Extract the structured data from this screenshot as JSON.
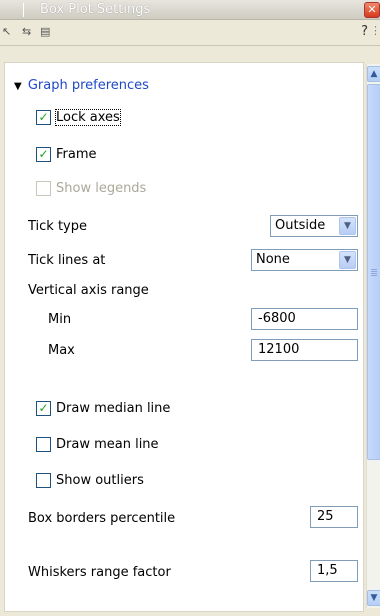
{
  "window": {
    "title": "Box Plot Settings",
    "close_glyph": "✕"
  },
  "toolbar": {
    "icons": [
      "cursor-arrow-icon",
      "cursor-arrows-icon",
      "layout-icon"
    ],
    "help": "?",
    "more": "⋮"
  },
  "section": {
    "title": "Graph preferences"
  },
  "options": {
    "lock_axes": {
      "label": "Lock axes",
      "checked": true
    },
    "frame": {
      "label": "Frame",
      "checked": true
    },
    "show_legends": {
      "label": "Show legends",
      "checked": false,
      "disabled": true
    }
  },
  "tick_type": {
    "label": "Tick type",
    "value": "Outside"
  },
  "tick_lines": {
    "label": "Tick lines at",
    "value": "None"
  },
  "vertical_axis": {
    "label": "Vertical axis range",
    "min_label": "Min",
    "min_value": "-6800",
    "max_label": "Max",
    "max_value": "12100"
  },
  "lines": {
    "draw_median": {
      "label": "Draw median line",
      "checked": true
    },
    "draw_mean": {
      "label": "Draw mean line",
      "checked": false
    },
    "show_outliers": {
      "label": "Show outliers",
      "checked": false
    }
  },
  "box_borders": {
    "label": "Box borders percentile",
    "value": "25"
  },
  "whiskers": {
    "label": "Whiskers range factor",
    "value": "1,5"
  },
  "colors": {
    "accent_blue": "#1e48c8",
    "check_green": "#21a121"
  }
}
